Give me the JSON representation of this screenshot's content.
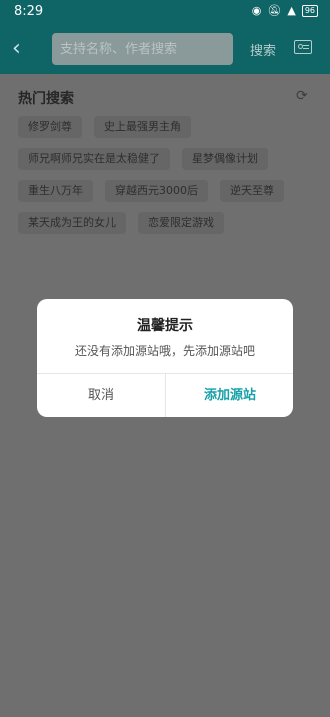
{
  "status_bar": {
    "time": "8:29",
    "battery": "96"
  },
  "toolbar": {
    "search_placeholder": "支持名称、作者搜索",
    "search_label": "搜索"
  },
  "hot_search": {
    "title": "热门搜索",
    "rows": [
      [
        "修罗剑尊",
        "史上最强男主角"
      ],
      [
        "师兄啊师兄实在是太稳健了",
        "星梦偶像计划"
      ],
      [
        "重生八万年",
        "穿越西元3000后",
        "逆天至尊"
      ],
      [
        "某天成为王的女儿",
        "恋爱限定游戏"
      ]
    ]
  },
  "dialog": {
    "title": "温馨提示",
    "message": "还没有添加源站哦，先添加源站吧",
    "cancel_label": "取消",
    "confirm_label": "添加源站"
  },
  "colors": {
    "toolbar": "#0f6466",
    "accent": "#16a0a8",
    "overlay_bg": "#6f6f6f"
  }
}
